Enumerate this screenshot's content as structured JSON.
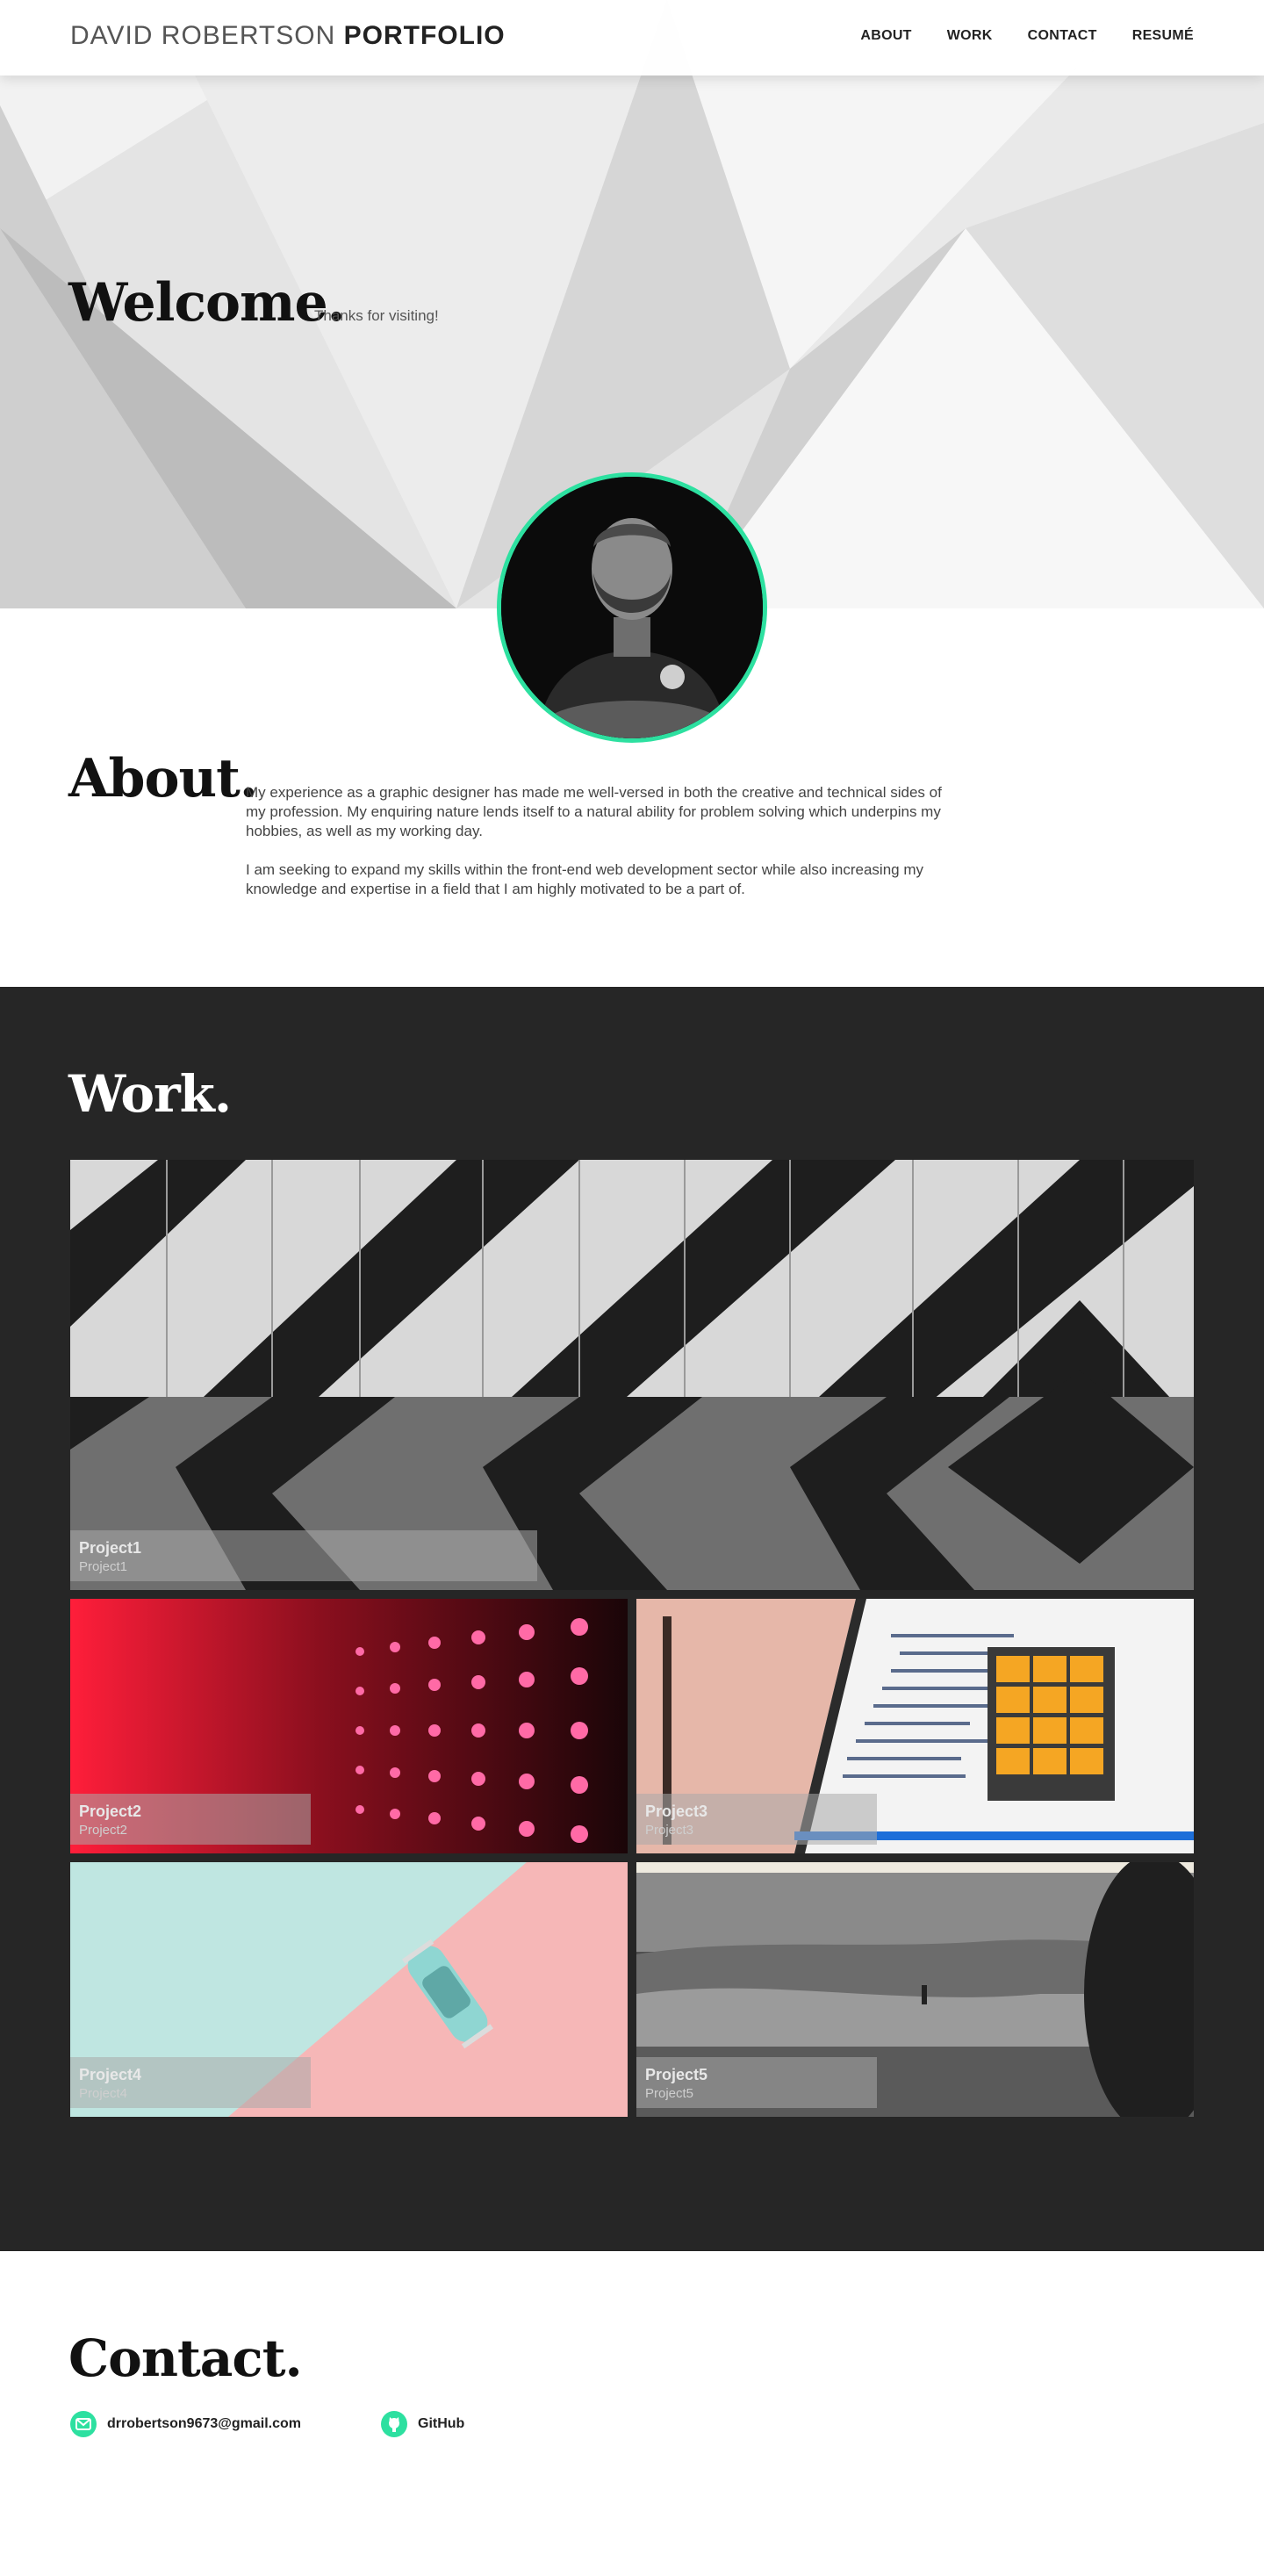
{
  "nav": {
    "brand_light": "DAVID ROBERTSON",
    "brand_bold": "PORTFOLIO",
    "items": [
      {
        "label": "ABOUT"
      },
      {
        "label": "WORK"
      },
      {
        "label": "CONTACT"
      },
      {
        "label": "RESUMÉ"
      }
    ]
  },
  "hero": {
    "heading": "Welcome.",
    "subheading": "Thanks for visiting!"
  },
  "about": {
    "heading": "About.",
    "paragraphs": [
      "My experience as a graphic designer has made me well-versed in both the creative and technical sides of my profession. My enquiring nature lends itself to a natural ability for problem solving which underpins my hobbies, as well as my working day.",
      "I am seeking to expand my skills within the front-end web development sector while also increasing my knowledge and expertise in a field that I am highly motivated to be a part of."
    ]
  },
  "work": {
    "heading": "Work.",
    "projects": [
      {
        "title": "Project1",
        "subtitle": "Project1"
      },
      {
        "title": "Project2",
        "subtitle": "Project2"
      },
      {
        "title": "Project3",
        "subtitle": "Project3"
      },
      {
        "title": "Project4",
        "subtitle": "Project4"
      },
      {
        "title": "Project5",
        "subtitle": "Project5"
      }
    ]
  },
  "contact": {
    "heading": "Contact.",
    "email": "drrobertson9673@gmail.com",
    "github": "GitHub"
  },
  "colors": {
    "accent": "#2de0a0",
    "work_bg": "#262626"
  }
}
